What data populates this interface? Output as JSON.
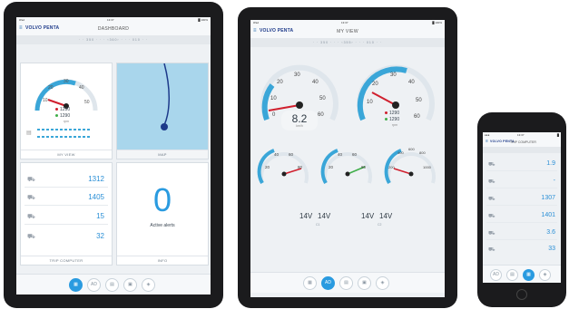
{
  "tablet1": {
    "statusbar": {
      "carrier": "iPad",
      "time": "13:37",
      "battery": " █ 100%"
    },
    "appbar": {
      "logo": "VOLVO PENTA",
      "title": "DASHBOARD"
    },
    "heading_tape": "· · 350 · · · ‹360› · · · 010 · ·",
    "my_view": {
      "gauge_ticks": [
        "10",
        "20",
        "30",
        "40",
        "50"
      ],
      "values": [
        "1290",
        "1290"
      ],
      "unit": "rpm",
      "footer": "MY VIEW"
    },
    "map": {
      "footer": "MAP"
    },
    "trip": {
      "values": [
        "1312",
        "1405",
        "15",
        "32"
      ],
      "footer": "TRIP COMPUTER"
    },
    "alerts": {
      "count": "0",
      "label": "Active alerts",
      "footer": "INFO"
    },
    "nav": [
      "▦",
      "AD",
      "▤",
      "▣",
      "◈"
    ]
  },
  "tablet2": {
    "statusbar": {
      "carrier": "iPad",
      "time": "13:37",
      "battery": " █ 100%"
    },
    "appbar": {
      "logo": "VOLVO PENTA",
      "title": "MY VIEW"
    },
    "heading_tape": "· · 350 · · · ‹355› · · · 010 · ·",
    "gauge_left": {
      "ticks": [
        "0",
        "10",
        "20",
        "30",
        "40",
        "50",
        "60"
      ],
      "speed": "8.2",
      "unit": "km/h"
    },
    "gauge_right": {
      "ticks": [
        "10",
        "20",
        "30",
        "40",
        "50",
        "60"
      ],
      "values": [
        "1290",
        "1290"
      ],
      "unit": "rpm"
    },
    "small_gauges": [
      {
        "ticks": [
          "20",
          "40",
          "60",
          "80"
        ]
      },
      {
        "ticks": [
          "20",
          "40",
          "60",
          "80"
        ]
      },
      {
        "ticks": [
          "200",
          "400",
          "600",
          "800",
          "1000"
        ]
      }
    ],
    "voltage": [
      {
        "a": "14V",
        "b": "14V",
        "label": "C1"
      },
      {
        "a": "14V",
        "b": "14V",
        "label": "C2"
      }
    ],
    "nav": [
      "▦",
      "AD",
      "▤",
      "▣",
      "◈"
    ]
  },
  "phone": {
    "statusbar": {
      "carrier": "●●●",
      "time": "13:37",
      "battery": "█"
    },
    "appbar": {
      "logo": "VOLVO PENTA",
      "title": "TRIP COMPUTER"
    },
    "values": [
      "1.9",
      "-",
      "1307",
      "1401",
      "3.6",
      "33"
    ],
    "nav": [
      "AD",
      "▤",
      "▦",
      "◈"
    ]
  },
  "colors": {
    "accent": "#2a9be0",
    "needle": "#d0202e",
    "arc": "#3aa6d8",
    "green": "#3fae49",
    "map": "#a9d6ec"
  }
}
